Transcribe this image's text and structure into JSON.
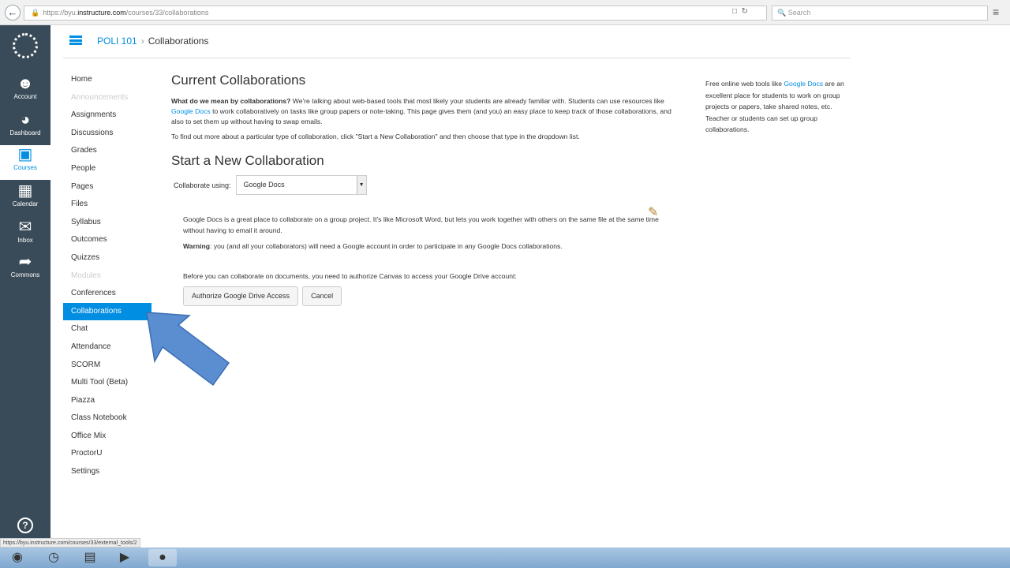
{
  "browser": {
    "url_prefix": "https://byu.",
    "url_domain": "instructure.com",
    "url_path": "/courses/33/collaborations",
    "search_placeholder": "Search"
  },
  "global_nav": {
    "items": [
      {
        "label": "Account",
        "icon": "user-icon"
      },
      {
        "label": "Dashboard",
        "icon": "dashboard-icon"
      },
      {
        "label": "Courses",
        "icon": "book-icon"
      },
      {
        "label": "Calendar",
        "icon": "calendar-icon"
      },
      {
        "label": "Inbox",
        "icon": "inbox-icon"
      },
      {
        "label": "Commons",
        "icon": "commons-icon"
      }
    ],
    "help": "?"
  },
  "header": {
    "course": "POLI 101",
    "page": "Collaborations"
  },
  "course_nav": [
    {
      "label": "Home"
    },
    {
      "label": "Announcements"
    },
    {
      "label": "Assignments"
    },
    {
      "label": "Discussions"
    },
    {
      "label": "Grades"
    },
    {
      "label": "People"
    },
    {
      "label": "Pages"
    },
    {
      "label": "Files"
    },
    {
      "label": "Syllabus"
    },
    {
      "label": "Outcomes"
    },
    {
      "label": "Quizzes"
    },
    {
      "label": "Modules"
    },
    {
      "label": "Conferences"
    },
    {
      "label": "Collaborations"
    },
    {
      "label": "Chat"
    },
    {
      "label": "Attendance"
    },
    {
      "label": "SCORM"
    },
    {
      "label": "Multi Tool (Beta)"
    },
    {
      "label": "Piazza"
    },
    {
      "label": "Class Notebook"
    },
    {
      "label": "Office Mix"
    },
    {
      "label": "ProctorU"
    },
    {
      "label": "Settings"
    }
  ],
  "main": {
    "title": "Current Collaborations",
    "intro_bold": "What do we mean by collaborations?",
    "intro_1": " We're talking about web-based tools that most likely your students are already familiar with. Students can use resources like ",
    "intro_link": "Google Docs",
    "intro_2": " to work collaboratively on tasks like group papers or note-taking. This page gives them (and you) an easy place to keep track of those collaborations, and also to set them up without having to swap emails.",
    "intro_p2": "To find out more about a particular type of collaboration, click \"Start a New Collaboration\" and then choose that type in the dropdown list.",
    "new_title": "Start a New Collaboration",
    "collab_label": "Collaborate using:",
    "collab_value": "Google Docs",
    "desc": "Google Docs is a great place to collaborate on a group project. It's like Microsoft Word, but lets you work together with others on the same file at the same time without having to email it around.",
    "warning_bold": "Warning",
    "warning_text": ": you (and all your collaborators) will need a Google account in order to participate in any Google Docs collaborations.",
    "authorize_text": "Before you can collaborate on documents, you need to authorize Canvas to access your Google Drive account:",
    "authorize_button": "Authorize Google Drive Access",
    "cancel_button": "Cancel"
  },
  "aside": {
    "text_1": "Free online web tools like ",
    "link": "Google Docs",
    "text_2": " are an excellent place for students to work on group projects or papers, take shared notes, etc. Teacher or students can set up group collaborations."
  },
  "status_url": "https://byu.instructure.com/courses/33/external_tools/2",
  "colors": {
    "accent": "#008ee2",
    "nav_bg": "#394b58",
    "arrow": "#5b8ed1"
  }
}
